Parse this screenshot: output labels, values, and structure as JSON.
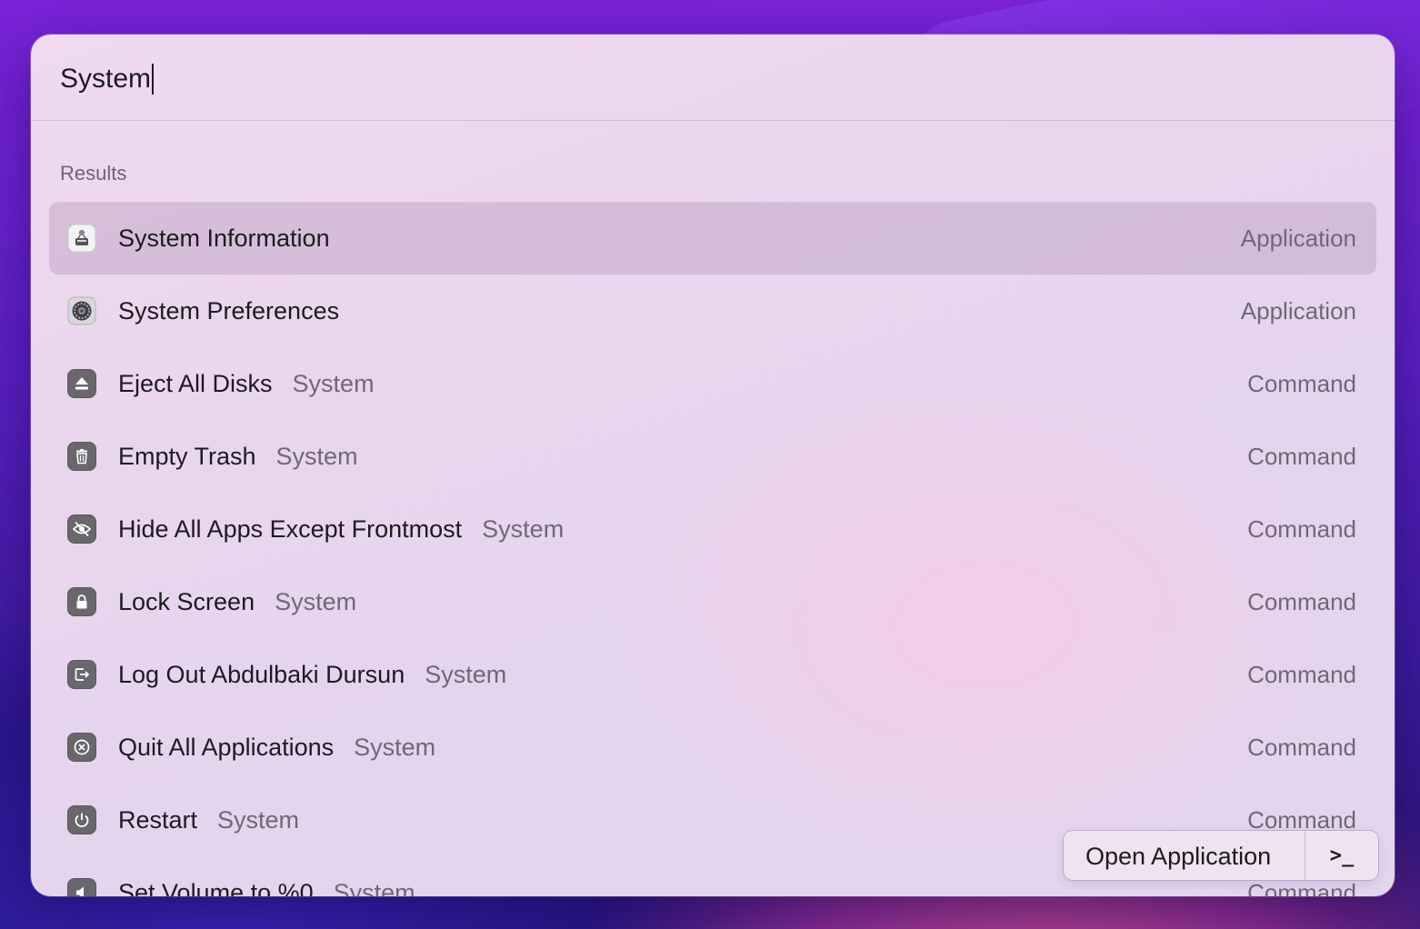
{
  "search": {
    "query": "System"
  },
  "section_title": "Results",
  "results": [
    {
      "title": "System Information",
      "subtitle": "",
      "kind": "Application",
      "icon": "system-information-icon",
      "selected": true
    },
    {
      "title": "System Preferences",
      "subtitle": "",
      "kind": "Application",
      "icon": "system-preferences-icon"
    },
    {
      "title": "Eject All Disks",
      "subtitle": "System",
      "kind": "Command",
      "icon": "eject-icon"
    },
    {
      "title": "Empty Trash",
      "subtitle": "System",
      "kind": "Command",
      "icon": "trash-icon"
    },
    {
      "title": "Hide All Apps Except Frontmost",
      "subtitle": "System",
      "kind": "Command",
      "icon": "eye-slash-icon"
    },
    {
      "title": "Lock Screen",
      "subtitle": "System",
      "kind": "Command",
      "icon": "lock-icon"
    },
    {
      "title": "Log Out Abdulbaki Dursun",
      "subtitle": "System",
      "kind": "Command",
      "icon": "logout-icon"
    },
    {
      "title": "Quit All Applications",
      "subtitle": "System",
      "kind": "Command",
      "icon": "quit-icon"
    },
    {
      "title": "Restart",
      "subtitle": "System",
      "kind": "Command",
      "icon": "power-icon"
    },
    {
      "title": "Set Volume to %0",
      "subtitle": "System",
      "kind": "Command",
      "icon": "speaker-icon"
    }
  ],
  "action_bar": {
    "primary_label": "Open Application",
    "shortcut_symbol": ">_"
  },
  "colors": {
    "selected_row": "#d6bfd9",
    "icon_bg": "#6a676c",
    "text": "#1d1a20",
    "muted": "#6f6875"
  }
}
